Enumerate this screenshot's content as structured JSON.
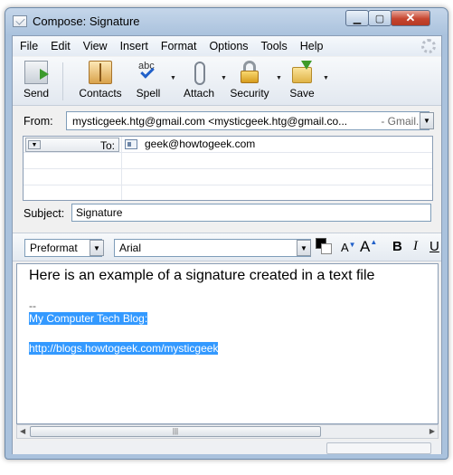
{
  "window": {
    "title": "Compose: Signature"
  },
  "menu": [
    "File",
    "Edit",
    "View",
    "Insert",
    "Format",
    "Options",
    "Tools",
    "Help"
  ],
  "toolbar": {
    "send": "Send",
    "contacts": "Contacts",
    "spell": "Spell",
    "spell_icon_text": "abc",
    "attach": "Attach",
    "security": "Security",
    "save": "Save"
  },
  "from": {
    "label": "From:",
    "value": "mysticgeek.htg@gmail.com <mysticgeek.htg@gmail.co...",
    "account": "- Gmail..."
  },
  "recipients": [
    {
      "type": "To:",
      "address": "geek@howtogeek.com"
    }
  ],
  "subject": {
    "label": "Subject:",
    "value": "Signature"
  },
  "format": {
    "paragraph": "Preformat",
    "font": "Arial",
    "text_color": "#000000",
    "bg_color": "#ffffff"
  },
  "body": {
    "main_text": "Here is an example of a signature created in a text file",
    "sig_separator": "--",
    "sig_line1": "My Computer Tech Blog:",
    "sig_line2": "http://blogs.howtogeek.com/mysticgeek"
  },
  "colors": {
    "selection": "#3399ff",
    "close_button": "#c6452f"
  }
}
